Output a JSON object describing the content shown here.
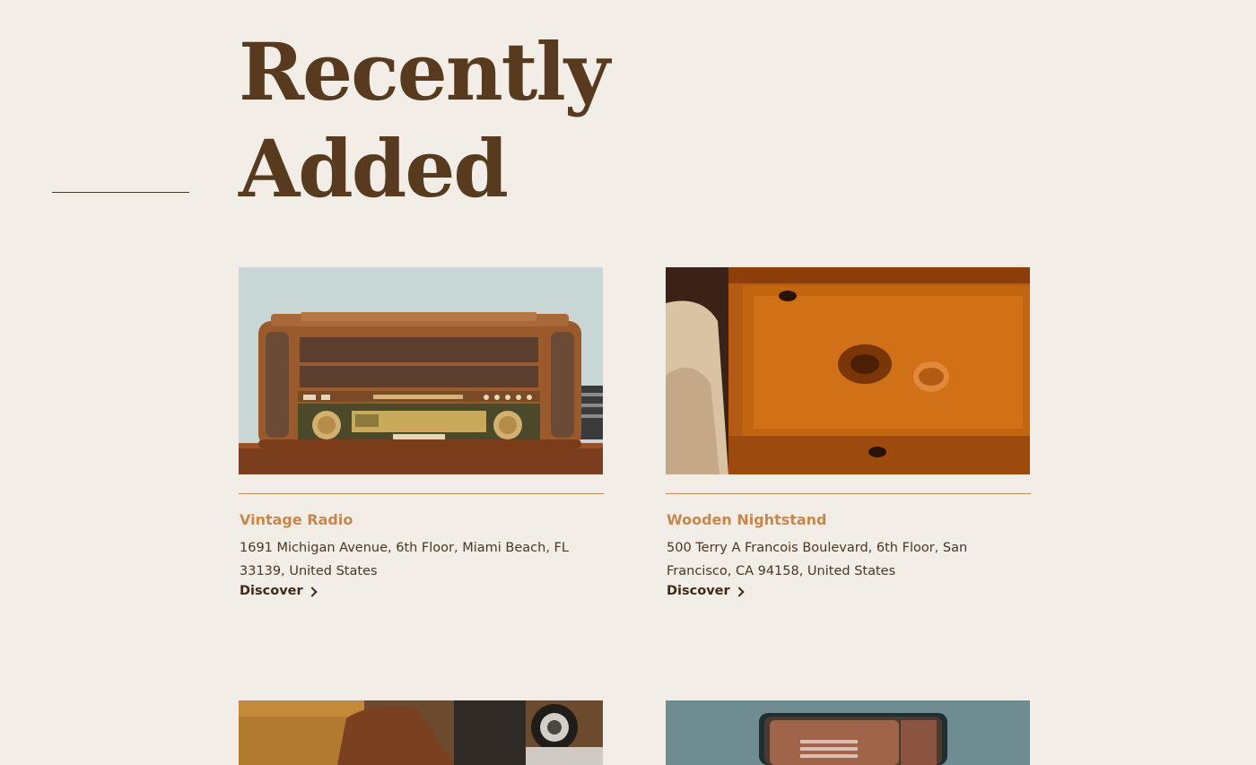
{
  "section": {
    "title_line1": "Recently",
    "title_line2": "Added"
  },
  "cards": [
    {
      "title": "Vintage Radio",
      "address": "1691 Michigan Avenue, 6th Floor, Miami Beach, FL 33139, United States",
      "link_label": "Discover",
      "image_subject": "vintage-radio-photo"
    },
    {
      "title": "Wooden Nightstand",
      "address": "500 Terry A Francois Boulevard, 6th Floor, San Francisco, CA 94158, United States",
      "link_label": "Discover",
      "image_subject": "wooden-nightstand-photo"
    },
    {
      "image_subject": "leather-camera-case-photo"
    },
    {
      "image_subject": "vintage-tin-box-photo"
    }
  ],
  "colors": {
    "background": "#f2ede7",
    "heading": "#583a1f",
    "accent": "#c8874a",
    "text": "#4a3622"
  }
}
